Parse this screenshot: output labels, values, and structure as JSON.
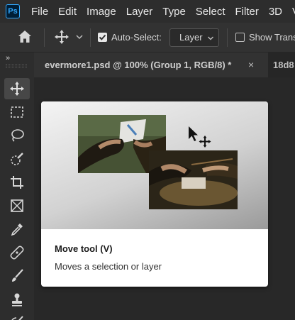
{
  "app": {
    "logo": "Ps"
  },
  "menu": [
    "File",
    "Edit",
    "Image",
    "Layer",
    "Type",
    "Select",
    "Filter",
    "3D",
    "V"
  ],
  "options": {
    "auto_select_label": "Auto-Select:",
    "auto_select_checked": true,
    "layer_value": "Layer",
    "show_transform_label": "Show Trans",
    "show_transform_checked": false
  },
  "toolbar": {
    "collapse_glyph": "»",
    "tools": [
      "move-icon",
      "marquee-icon",
      "lasso-icon",
      "quick-select-icon",
      "crop-icon",
      "frame-icon",
      "eyedropper-icon",
      "healing-brush-icon",
      "brush-icon",
      "stamp-icon",
      "history-brush-icon"
    ],
    "active_tool": "move-icon"
  },
  "tabs": [
    {
      "label": "evermore1.psd @ 100% (Group 1, RGB/8) *",
      "close": "×"
    },
    {
      "label": "18d8"
    }
  ],
  "tooltip": {
    "title": "Move tool (V)",
    "description": "Moves a selection or layer"
  },
  "colors": {
    "accent": "#31a8ff",
    "menubar": "#2d2d2d",
    "canvas": "#282828"
  }
}
